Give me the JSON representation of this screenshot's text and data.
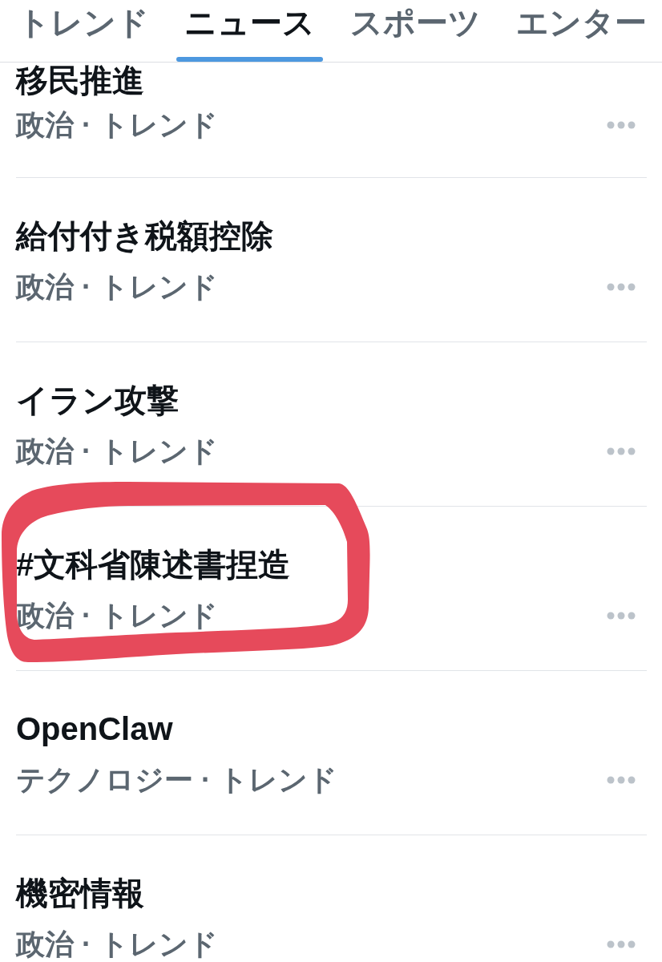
{
  "tabs": [
    {
      "label": "トレンド",
      "selected": false
    },
    {
      "label": "ニュース",
      "selected": true
    },
    {
      "label": "スポーツ",
      "selected": false
    },
    {
      "label": "エンター",
      "selected": false
    }
  ],
  "trends": [
    {
      "title": "移民推進",
      "context": "政治 · トレンド",
      "circled": false
    },
    {
      "title": "給付付き税額控除",
      "context": "政治 · トレンド",
      "circled": false
    },
    {
      "title": "イラン攻撃",
      "context": "政治 · トレンド",
      "circled": false
    },
    {
      "title": "#文科省陳述書捏造",
      "context": "政治 · トレンド",
      "circled": true
    },
    {
      "title": "OpenClaw",
      "context": "テクノロジー · トレンド",
      "circled": false
    },
    {
      "title": "機密情報",
      "context": "政治 · トレンド",
      "circled": false
    }
  ]
}
